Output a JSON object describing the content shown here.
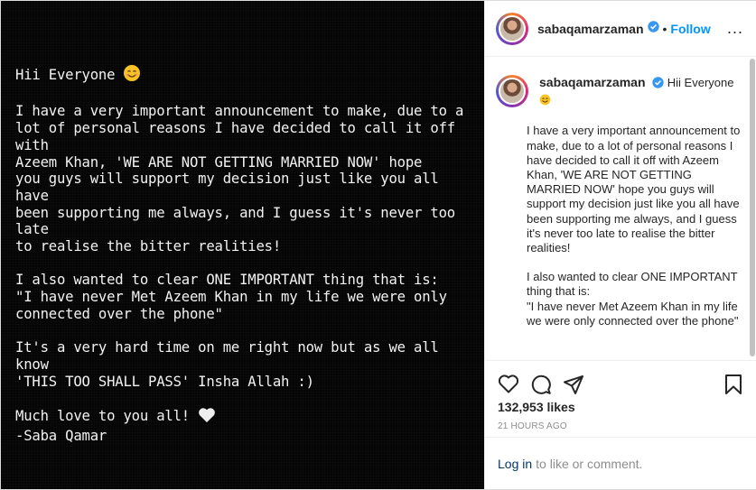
{
  "image_text": {
    "greeting": "Hii Everyone",
    "para1": [
      "I have a very important announcement to make, due to a",
      "lot of personal reasons I have decided to call it off with",
      "Azeem Khan, 'WE ARE NOT GETTING MARRIED NOW' hope",
      "you guys will support my decision just like you all have",
      "been supporting me always, and I guess it's never too late",
      "to realise the bitter realities!"
    ],
    "para2": [
      "I also wanted to clear ONE IMPORTANT thing that is:",
      "\"I have never Met Azeem Khan in my life we were only",
      "connected over the phone\""
    ],
    "para3": [
      "It's a very hard time on me right now but as we all know",
      "'THIS TOO SHALL PASS'  Insha Allah :)"
    ],
    "signoff": "Much love to you all!",
    "signature": "-Saba Qamar"
  },
  "header": {
    "username": "sabaqamarzaman",
    "separator": "•",
    "follow_label": "Follow",
    "more_label": "..."
  },
  "caption": {
    "username": "sabaqamarzaman",
    "first_line": "Hii Everyone",
    "paragraph1": "I have a very important announcement to make, due to a lot of personal reasons I have decided to call it off with Azeem Khan, 'WE ARE NOT GETTING MARRIED NOW' hope you guys will support my decision just like you all have been supporting me always, and I guess it's never too late to realise the bitter realities!",
    "paragraph2": "I also wanted to clear ONE IMPORTANT thing that is:",
    "paragraph3": "\"I have never Met Azeem Khan in my life we were only connected over the phone\""
  },
  "stats": {
    "likes": "132,953 likes",
    "time": "21 HOURS AGO"
  },
  "footer": {
    "login_label": "Log in",
    "login_suffix": "to like or comment."
  },
  "colors": {
    "follow": "#0095f6",
    "verified": "#3897f0",
    "link": "#00376b",
    "muted": "#8e8e8e"
  }
}
